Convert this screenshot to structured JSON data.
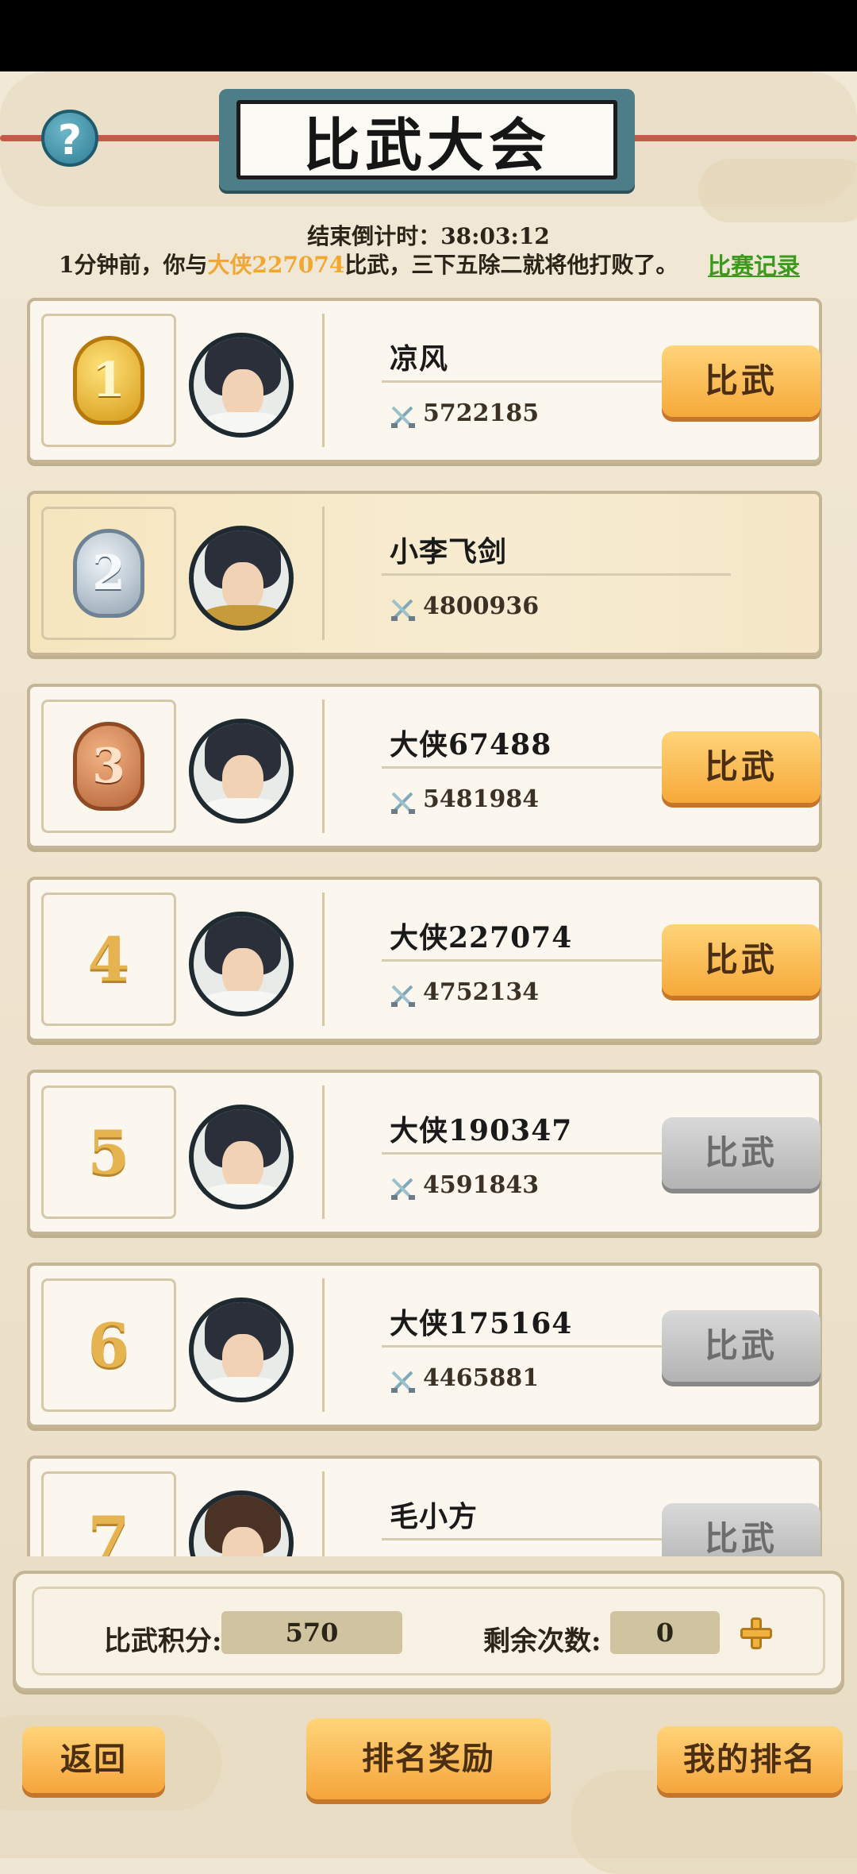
{
  "header": {
    "title": "比武大会",
    "help_icon": "help-icon",
    "countdown_label": "结束倒计时：38:03:12",
    "news_prefix": "1分钟前，你与",
    "news_name": "大侠227074",
    "news_suffix": "比武，三下五除二就将他打败了。",
    "record_link": "比赛记录",
    "highlight_color": "#f0a832",
    "link_color": "#3b9a1c"
  },
  "players": [
    {
      "rank": "1",
      "medal": "gold",
      "name": "凉风",
      "power": "5722185",
      "button": "比武",
      "button_state": "enabled"
    },
    {
      "rank": "2",
      "medal": "silver",
      "name": "小李飞剑",
      "power": "4800936",
      "button": "",
      "button_state": "self"
    },
    {
      "rank": "3",
      "medal": "bronze",
      "name": "大侠67488",
      "power": "5481984",
      "button": "比武",
      "button_state": "enabled"
    },
    {
      "rank": "4",
      "medal": "",
      "name": "大侠227074",
      "power": "4752134",
      "button": "比武",
      "button_state": "enabled"
    },
    {
      "rank": "5",
      "medal": "",
      "name": "大侠190347",
      "power": "4591843",
      "button": "比武",
      "button_state": "disabled"
    },
    {
      "rank": "6",
      "medal": "",
      "name": "大侠175164",
      "power": "4465881",
      "button": "比武",
      "button_state": "disabled"
    },
    {
      "rank": "7",
      "medal": "",
      "name": "毛小方",
      "power": "",
      "button": "比武",
      "button_state": "disabled"
    }
  ],
  "stats": {
    "score_label": "比武积分:",
    "score_value": "570",
    "remaining_label": "剩余次数:",
    "remaining_value": "0"
  },
  "footer": {
    "back": "返回",
    "rank_rewards": "排名奖励",
    "my_rank": "我的排名"
  },
  "colors": {
    "button_orange": "#f6a93a",
    "button_grey": "#b3b3b3",
    "panel_bg": "#fbf7ee"
  }
}
